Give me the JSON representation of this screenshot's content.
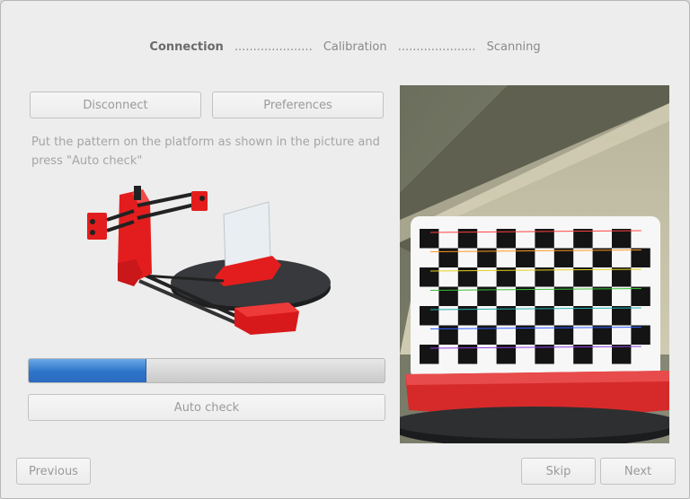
{
  "wizard": {
    "steps": [
      {
        "label": "Connection",
        "active": true
      },
      {
        "label": "Calibration",
        "active": false
      },
      {
        "label": "Scanning",
        "active": false
      }
    ],
    "separator": "....................."
  },
  "connection": {
    "disconnect_label": "Disconnect",
    "preferences_label": "Preferences",
    "instructions": "Put the pattern on the platform as shown in the picture and press \"Auto check\"",
    "progress_fraction": 0.33,
    "auto_check_label": "Auto check"
  },
  "footer": {
    "previous_label": "Previous",
    "skip_label": "Skip",
    "next_label": "Next"
  },
  "colors": {
    "progress": "#2d74c8",
    "scanner_red": "#e31d1d",
    "platform": "#2f3033"
  },
  "icons": {
    "scanner_image": "3d-scanner-illustration",
    "camera_feed": "camera-preview"
  }
}
